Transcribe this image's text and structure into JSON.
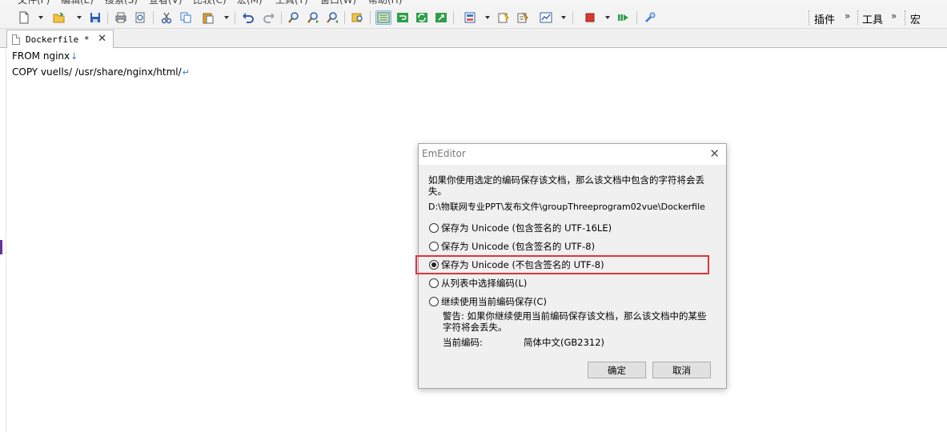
{
  "menubar": {
    "items": [
      "文件(F)",
      "编辑(E)",
      "搜索(S)",
      "查看(V)",
      "比较(C)",
      "宏(M)",
      "工具(T)",
      "窗口(W)",
      "帮助(H)"
    ]
  },
  "toolbar": {
    "plugins_label": "插件",
    "tools_label": "工具",
    "macros_label": "宏",
    "overflow_glyph": "»"
  },
  "tab": {
    "title": "Dockerfile *",
    "close_glyph": "✕"
  },
  "editor": {
    "lines": [
      {
        "text": "FROM nginx",
        "eol": "↓"
      },
      {
        "text": "COPY vuells/ /usr/share/nginx/html/",
        "eol": "↵"
      }
    ]
  },
  "dialog": {
    "title": "EmEditor",
    "close_glyph": "✕",
    "message": "如果你使用选定的编码保存该文档，那么该文档中包含的字符将会丢失。",
    "file_path": "D:\\物联网专业PPT\\发布文件\\groupThreeprogram02vue\\Dockerfile",
    "options": [
      {
        "label": "保存为 Unicode (包含签名的 UTF-16LE)",
        "checked": false
      },
      {
        "label": "保存为 Unicode (包含签名的 UTF-8)",
        "checked": false
      },
      {
        "label": "保存为 Unicode (不包含签名的 UTF-8)",
        "checked": true
      },
      {
        "label": "从列表中选择编码(L)",
        "checked": false
      },
      {
        "label": "继续使用当前编码保存(C)",
        "checked": false
      }
    ],
    "warning": "警告: 如果你继续使用当前编码保存该文档，那么该文档中的某些字符将会丢失。",
    "current_encoding_label": "当前编码:",
    "current_encoding_value": "简体中文(GB2312)",
    "ok_label": "确定",
    "cancel_label": "取消",
    "highlight_color": "#e0353b"
  }
}
